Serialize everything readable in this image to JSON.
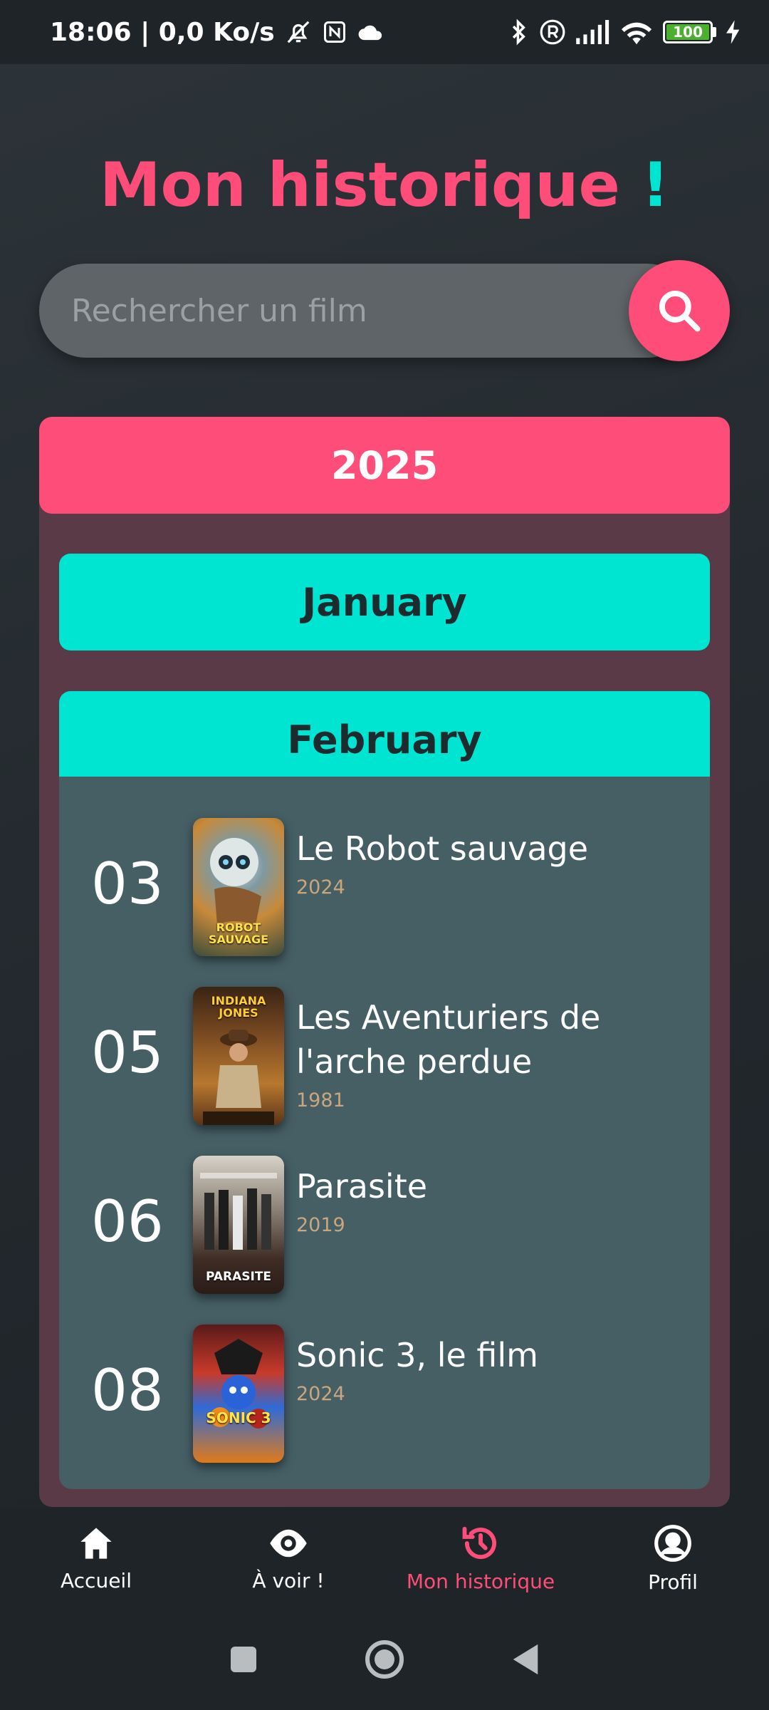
{
  "status_bar": {
    "time_speed": "18:06 | 0,0 Ko/s",
    "battery": "100"
  },
  "page": {
    "title": "Mon historique",
    "title_suffix": "!"
  },
  "search": {
    "placeholder": "Rechercher un film"
  },
  "history": {
    "year": "2025",
    "months": [
      {
        "label": "January"
      },
      {
        "label": "February"
      }
    ],
    "entries": [
      {
        "day": "03",
        "title": "Le Robot sauvage",
        "year": "2024",
        "poster_caption": "ROBOT SAUVAGE"
      },
      {
        "day": "05",
        "title": "Les Aventuriers de l'arche perdue",
        "year": "1981",
        "poster_caption": "INDIANA JONES"
      },
      {
        "day": "06",
        "title": "Parasite",
        "year": "2019",
        "poster_caption": "PARASITE"
      },
      {
        "day": "08",
        "title": "Sonic 3, le film",
        "year": "2024",
        "poster_caption": "SONIC 3"
      }
    ]
  },
  "bottom_nav": {
    "items": [
      {
        "label": "Accueil",
        "icon": "home-icon"
      },
      {
        "label": "À voir !",
        "icon": "eye-icon"
      },
      {
        "label": "Mon historique",
        "icon": "history-icon",
        "active": true
      },
      {
        "label": "Profil",
        "icon": "profile-icon"
      }
    ]
  },
  "colors": {
    "accent_pink": "#ff4d7a",
    "accent_teal": "#00e5d1"
  }
}
